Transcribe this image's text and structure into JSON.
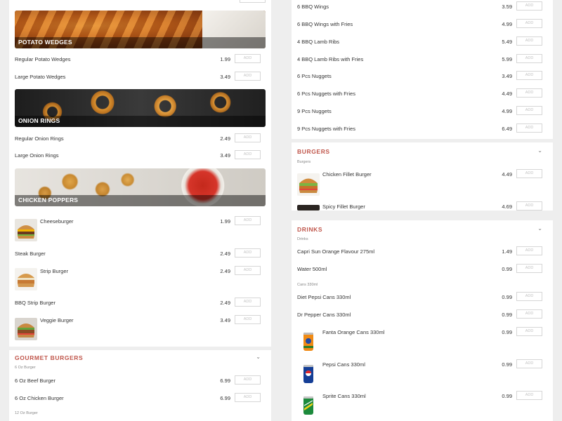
{
  "colors": {
    "accent": "#c0564b",
    "page_bg": "#eeeeee",
    "card_bg": "#ffffff"
  },
  "add_label": "ADD",
  "potato": {
    "banner": "POTATO WEDGES",
    "items": [
      {
        "name": "Regular Potato Wedges",
        "price": "1.99"
      },
      {
        "name": "Large Potato Wedges",
        "price": "3.49"
      }
    ]
  },
  "onion": {
    "banner": "ONION RINGS",
    "items": [
      {
        "name": "Regular Onion Rings",
        "price": "2.49"
      },
      {
        "name": "Large Onion Rings",
        "price": "3.49"
      }
    ]
  },
  "poppers": {
    "banner": "CHICKEN POPPERS"
  },
  "wings": {
    "items": [
      {
        "name": "6 BBQ Wings",
        "price": "3.59"
      },
      {
        "name": "6 BBQ Wings with Fries",
        "price": "4.99"
      },
      {
        "name": "4 BBQ Lamb Ribs",
        "price": "5.49"
      },
      {
        "name": "4 BBQ Lamb Ribs with Fries",
        "price": "5.99"
      },
      {
        "name": "6 Pcs Nuggets",
        "price": "3.49"
      },
      {
        "name": "6 Pcs Nuggets with Fries",
        "price": "4.49"
      },
      {
        "name": "9 Pcs Nuggets",
        "price": "4.99"
      },
      {
        "name": "9 Pcs Nuggets with Fries",
        "price": "6.49"
      }
    ]
  },
  "burgers": {
    "title": "BURGERS",
    "sub": "Burgers",
    "items": [
      {
        "name": "Chicken Fillet Burger",
        "price": "4.49",
        "icon": "burger-icon"
      },
      {
        "name": "Spicy Fillet Burger",
        "price": "4.69",
        "icon": "burger-icon"
      }
    ]
  },
  "burgers_list": {
    "items": [
      {
        "name": "Cheeseburger",
        "price": "1.99",
        "icon": "cheeseburger-icon"
      },
      {
        "name": "Steak Burger",
        "price": "2.49"
      },
      {
        "name": "Strip Burger",
        "price": "2.49",
        "icon": "strip-burger-icon"
      },
      {
        "name": "BBQ Strip Burger",
        "price": "2.49"
      },
      {
        "name": "Veggie Burger",
        "price": "3.49",
        "icon": "veggie-burger-icon"
      }
    ]
  },
  "gourmet": {
    "title": "GOURMET BURGERS",
    "sub1": "6 Oz Burger",
    "items": [
      {
        "name": "6 Oz Beef Burger",
        "price": "6.99"
      },
      {
        "name": "6 Oz Chicken Burger",
        "price": "6.99"
      }
    ],
    "sub2": "12 Oz Burger"
  },
  "drinks": {
    "title": "DRINKS",
    "sub1": "Drinks",
    "items1": [
      {
        "name": "Capri Sun Orange Flavour 275ml",
        "price": "1.49"
      },
      {
        "name": "Water 500ml",
        "price": "0.99"
      }
    ],
    "sub2": "Cans 330ml",
    "items2": [
      {
        "name": "Diet Pepsi Cans 330ml",
        "price": "0.99"
      },
      {
        "name": "Dr Pepper Cans 330ml",
        "price": "0.99"
      },
      {
        "name": "Fanta Orange Cans 330ml",
        "price": "0.99",
        "icon": "fanta-can-icon"
      },
      {
        "name": "Pepsi Cans 330ml",
        "price": "0.99",
        "icon": "pepsi-can-icon"
      },
      {
        "name": "Sprite Cans 330ml",
        "price": "0.99",
        "icon": "sprite-can-icon"
      }
    ]
  }
}
